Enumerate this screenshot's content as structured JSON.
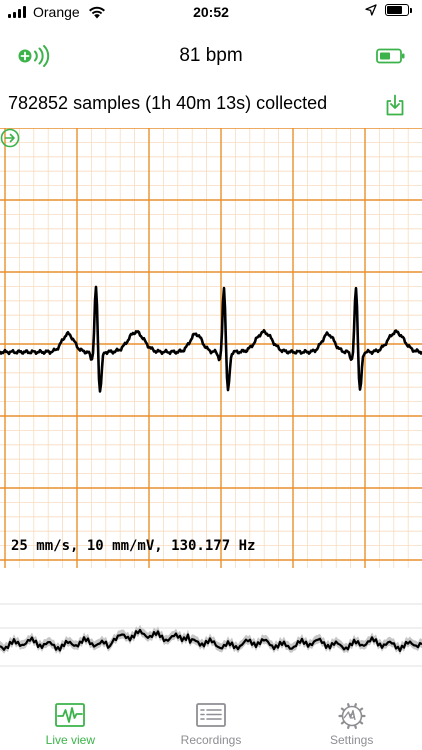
{
  "status_bar": {
    "carrier": "Orange",
    "time": "20:52",
    "battery_level": 0.75
  },
  "header": {
    "title": "81 bpm",
    "left_icon": "sensor-connected-icon",
    "right_icon": "battery-icon"
  },
  "info": {
    "samples_text": "782852 samples (1h 40m 13s) collected",
    "download_icon": "download-icon"
  },
  "chart": {
    "speed_label": "25 mm/s, 10 mm/mV, 130.177 Hz",
    "forward_icon": "forward-icon"
  },
  "tabs": [
    {
      "label": "Live view",
      "icon": "live-view-icon",
      "active": true
    },
    {
      "label": "Recordings",
      "icon": "recordings-icon",
      "active": false
    },
    {
      "label": "Settings",
      "icon": "settings-icon",
      "active": false
    }
  ],
  "colors": {
    "accent": "#3cb34a",
    "grid_major": "#e8912e",
    "grid_minor": "#f6dcbf",
    "tab_inactive": "#8e8e93"
  }
}
